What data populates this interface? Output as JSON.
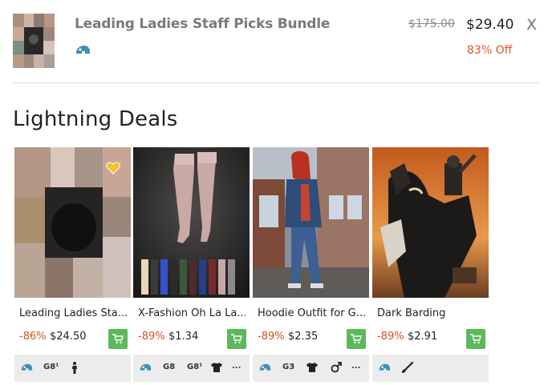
{
  "cart_item": {
    "title": "Leading Ladies Staff Picks Bundle",
    "original_price": "$175.00",
    "sale_price": "$29.40",
    "discount": "83% Off",
    "remove_label": "X",
    "generation_icon": "genesis-helmet-icon"
  },
  "section": {
    "title": "Lightning Deals"
  },
  "deals": [
    {
      "name": "Leading Ladies Sta...",
      "discount": "-86%",
      "price": "$24.50",
      "favorited": true,
      "tags": [
        "genesis-helmet-icon",
        "G8¹",
        "female-figure-icon"
      ]
    },
    {
      "name": "X-Fashion Oh La La...",
      "discount": "-89%",
      "price": "$1.34",
      "favorited": false,
      "tags": [
        "genesis-helmet-icon",
        "G8",
        "G8¹",
        "shirt-icon",
        "..."
      ]
    },
    {
      "name": "Hoodie Outfit for G...",
      "discount": "-89%",
      "price": "$2.35",
      "favorited": false,
      "tags": [
        "genesis-helmet-icon",
        "G3",
        "shirt-icon",
        "male-symbol-icon",
        "..."
      ]
    },
    {
      "name": "Dark Barding",
      "discount": "-89%",
      "price": "$2.91",
      "favorited": false,
      "tags": [
        "genesis-helmet-icon",
        "brush-icon"
      ]
    }
  ],
  "colors": {
    "discount_red": "#e8532c",
    "cart_green": "#5cb85c",
    "helmet_blue": "#3d8fb8",
    "heart_gold": "#f2c230"
  }
}
